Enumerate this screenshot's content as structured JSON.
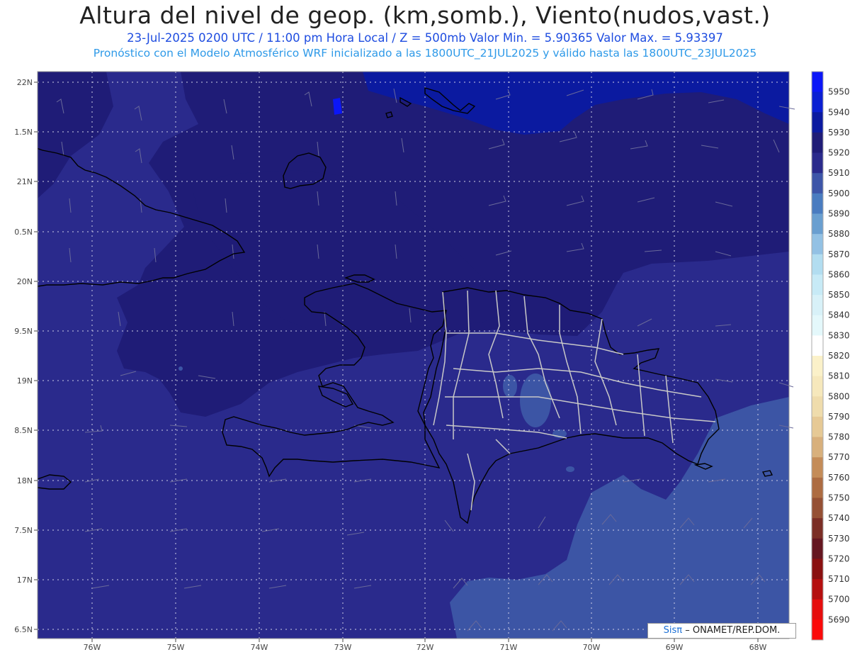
{
  "header": {
    "title": "Altura del nivel de geop. (km,somb.), Viento(nudos,vast.)",
    "subtitle": "23-Jul-2025  0200 UTC / 11:00 pm Hora Local / Z = 500mb    Valor Min. = 5.90365   Valor Max. = 5.93397",
    "subtitle2": "Pronóstico con el Modelo Atmosférico WRF inicializado a las 1800UTC_21JUL2025 y válido hasta las  1800UTC_23JUL2025"
  },
  "axes": {
    "lat_labels": [
      "22N",
      "1.5N",
      "21N",
      "0.5N",
      "20N",
      "9.5N",
      "19N",
      "8.5N",
      "18N",
      "7.5N",
      "17N",
      "6.5N"
    ],
    "lon_labels": [
      "76W",
      "75W",
      "74W",
      "73W",
      "72W",
      "71W",
      "70W",
      "69W",
      "68W"
    ]
  },
  "colorbar": {
    "levels": [
      "5950",
      "5940",
      "5930",
      "5920",
      "5910",
      "5900",
      "5890",
      "5880",
      "5870",
      "5860",
      "5850",
      "5840",
      "5830",
      "5820",
      "5810",
      "5800",
      "5790",
      "5780",
      "5770",
      "5760",
      "5750",
      "5740",
      "5730",
      "5720",
      "5710",
      "5700",
      "5690"
    ],
    "colors": [
      "#0b16f7",
      "#0a1fd2",
      "#0b1aa0",
      "#1f1c77",
      "#2a2a8c",
      "#3d55a8",
      "#4a7cc0",
      "#6a9fd0",
      "#93c1e4",
      "#b2ddf0",
      "#c7eaf6",
      "#d8f1f8",
      "#e4f8fb",
      "#ffffff",
      "#fbf1c9",
      "#f6e8bc",
      "#efdcac",
      "#e6c995",
      "#d8b07c",
      "#c48c58",
      "#ad6c42",
      "#955034",
      "#7b2e25",
      "#651620",
      "#8a1010",
      "#b50f0f",
      "#e60d0d",
      "#fb0a0a"
    ]
  },
  "legend": {
    "logo": "Sisπ",
    "credit": "– ONAMET/REP.DOM."
  },
  "colors": {
    "field_5920": "#1f1c77",
    "field_5910": "#2a2a8c",
    "field_5900": "#3c55a5",
    "field_5930": "#0b1aa0"
  }
}
